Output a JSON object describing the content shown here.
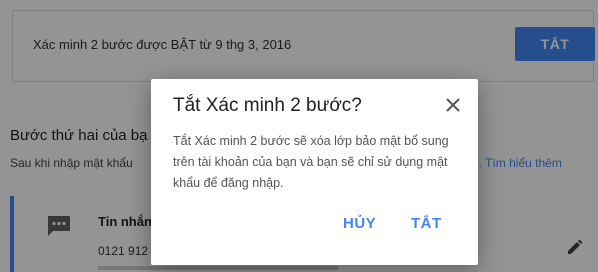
{
  "background": {
    "status_text": "Xác minh 2 bước được BẬT từ 9 thg 3, 2016",
    "turn_off_button": "TẮT",
    "second_step_title": "Bước thứ hai của bạ",
    "second_step_desc": "Sau khi nhập mật khẩu",
    "learn_more_link": "i. Tìm hiểu thêm",
    "sms_title": "Tin nhắn",
    "sms_phone": "0121 912"
  },
  "dialog": {
    "title": "Tắt Xác minh 2 bước?",
    "body": "Tắt Xác minh 2 bước sẽ xóa lớp bảo mật bổ sung trên tài khoản của bạn và bạn sẽ chỉ sử dụng mật khẩu để đăng nhập.",
    "cancel_label": "HỦY",
    "confirm_label": "TẮT"
  },
  "icons": {
    "close": "close-icon",
    "message": "message-icon",
    "edit": "pencil-icon"
  },
  "colors": {
    "accent": "#4285f4",
    "scrim": "rgba(0,0,0,0.42)"
  }
}
